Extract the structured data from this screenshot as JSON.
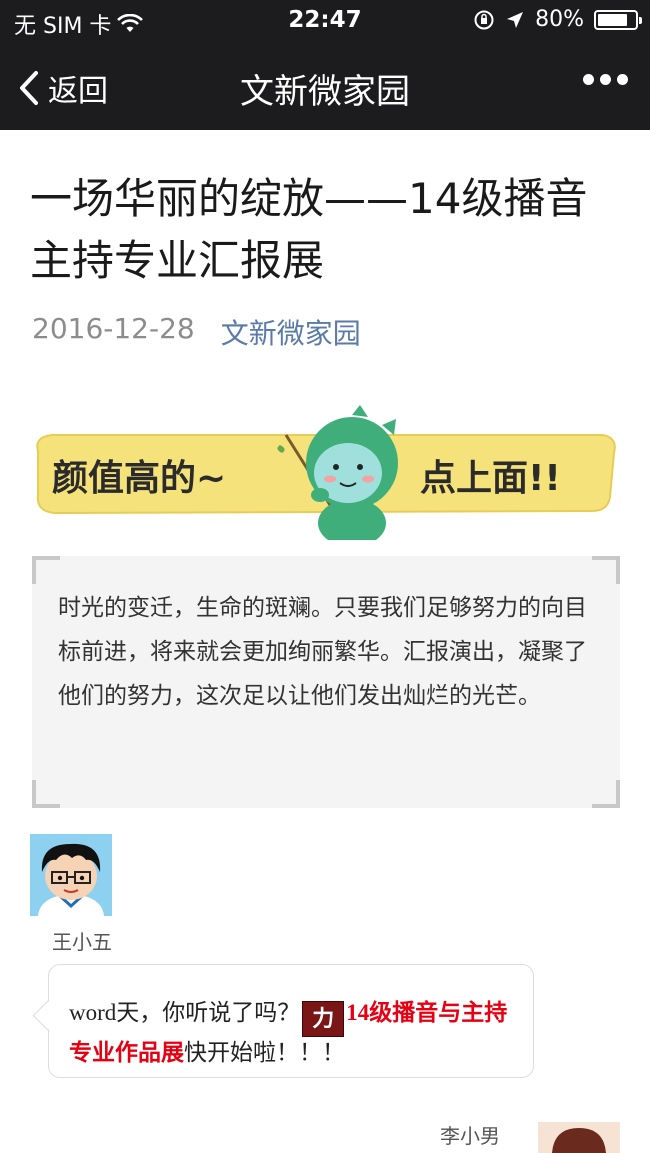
{
  "status_bar": {
    "carrier": "无 SIM 卡",
    "time": "22:47",
    "battery": "80%",
    "battery_level": 0.8
  },
  "nav": {
    "back_label": "返回",
    "title": "文新微家园"
  },
  "article": {
    "title": "一场华丽的绽放——14级播音主持专业汇报展",
    "date": "2016-12-28",
    "account": "文新微家园",
    "banner": {
      "left_text": "颜值高的~",
      "right_text": "点上面!!"
    },
    "quote": "时光的变迁，生命的斑斓。只要我们足够努力的向目标前进，将来就会更加绚丽繁华。汇报演出，凝聚了他们的努力，这次足以让他们发出灿烂的光芒。"
  },
  "chat": {
    "speaker1": "王小五",
    "message_prefix": "word天，你听说了吗？",
    "icon_char": "力",
    "message_highlight": "14级播音与主持专业作品展",
    "message_suffix": "快开始啦！！！",
    "speaker2": "李小男"
  },
  "colors": {
    "nav_bg": "#1c1c1e",
    "account_link": "#5a7aa8",
    "highlight_red": "#e60012",
    "banner_yellow": "#f5e27a",
    "mascot_green": "#3fae7a"
  }
}
